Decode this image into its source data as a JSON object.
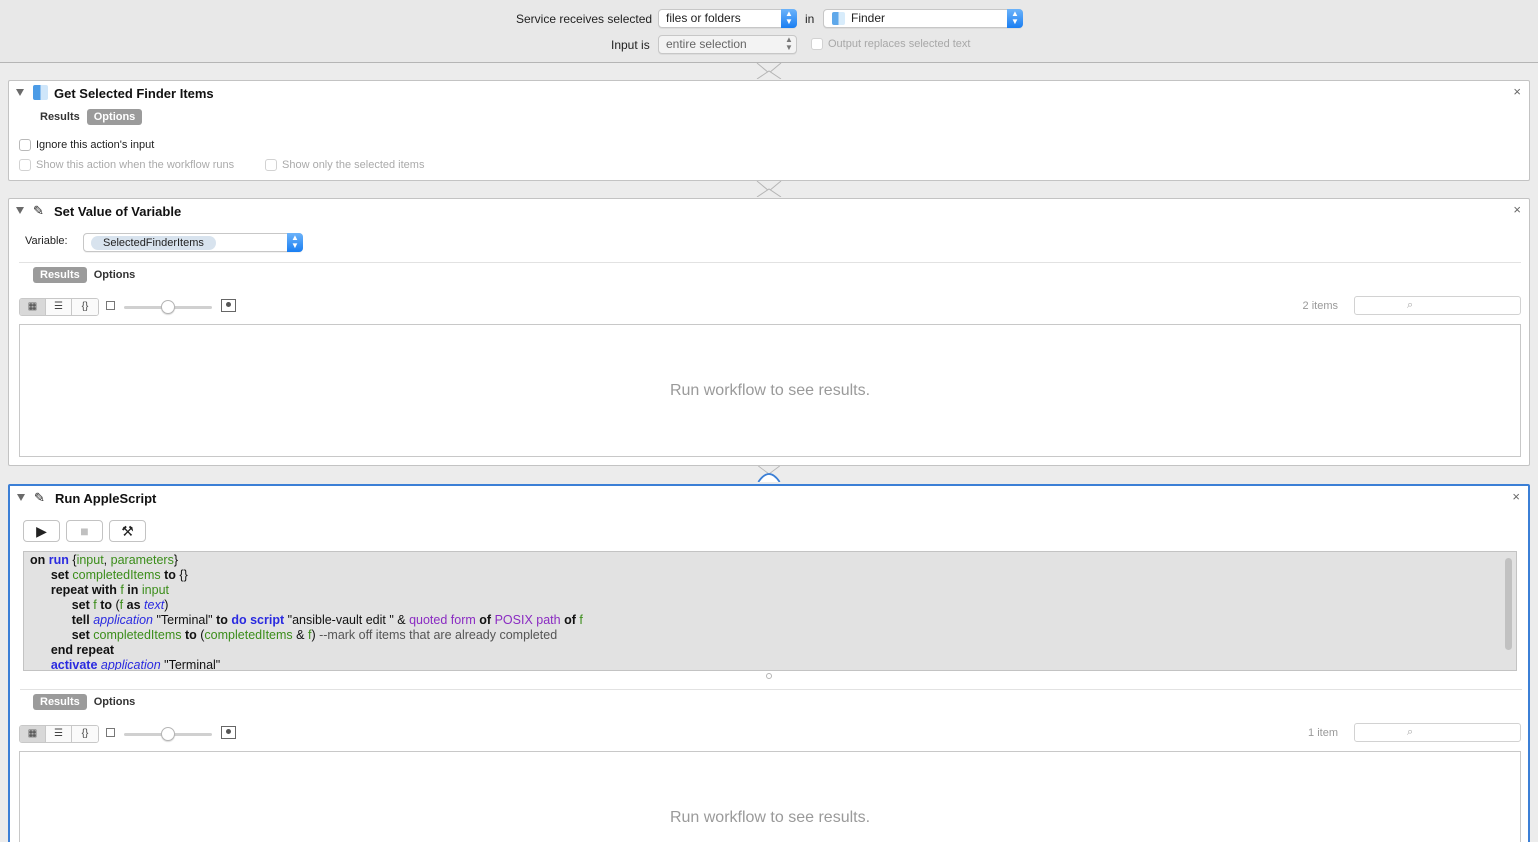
{
  "topbar": {
    "receives_label": "Service receives selected",
    "receives_value": "files or folders",
    "in_label": "in",
    "app_value": "Finder",
    "input_label": "Input is",
    "input_value": "entire selection",
    "output_replaces_label": "Output replaces selected text"
  },
  "actions": [
    {
      "title": "Get Selected Finder Items",
      "tabs": [
        "Results",
        "Options"
      ],
      "active_tab": "Options",
      "options": {
        "ignore_input": "Ignore this action's input",
        "show_when_runs": "Show this action when the workflow runs",
        "show_selected": "Show only the selected items"
      }
    },
    {
      "title": "Set Value of Variable",
      "variable_label": "Variable:",
      "variable_value": "SelectedFinderItems",
      "tabs": [
        "Results",
        "Options"
      ],
      "active_tab": "Results",
      "items_count": "2 items",
      "results_message": "Run workflow to see results."
    },
    {
      "title": "Run AppleScript",
      "tabs": [
        "Results",
        "Options"
      ],
      "active_tab": "Results",
      "items_count": "1 item",
      "results_message": "Run workflow to see results."
    }
  ],
  "close_glyph": "×",
  "icons": [
    "finder-icon",
    "automator-icon",
    "run-icon",
    "stop-icon",
    "compile-icon",
    "search-icon"
  ]
}
